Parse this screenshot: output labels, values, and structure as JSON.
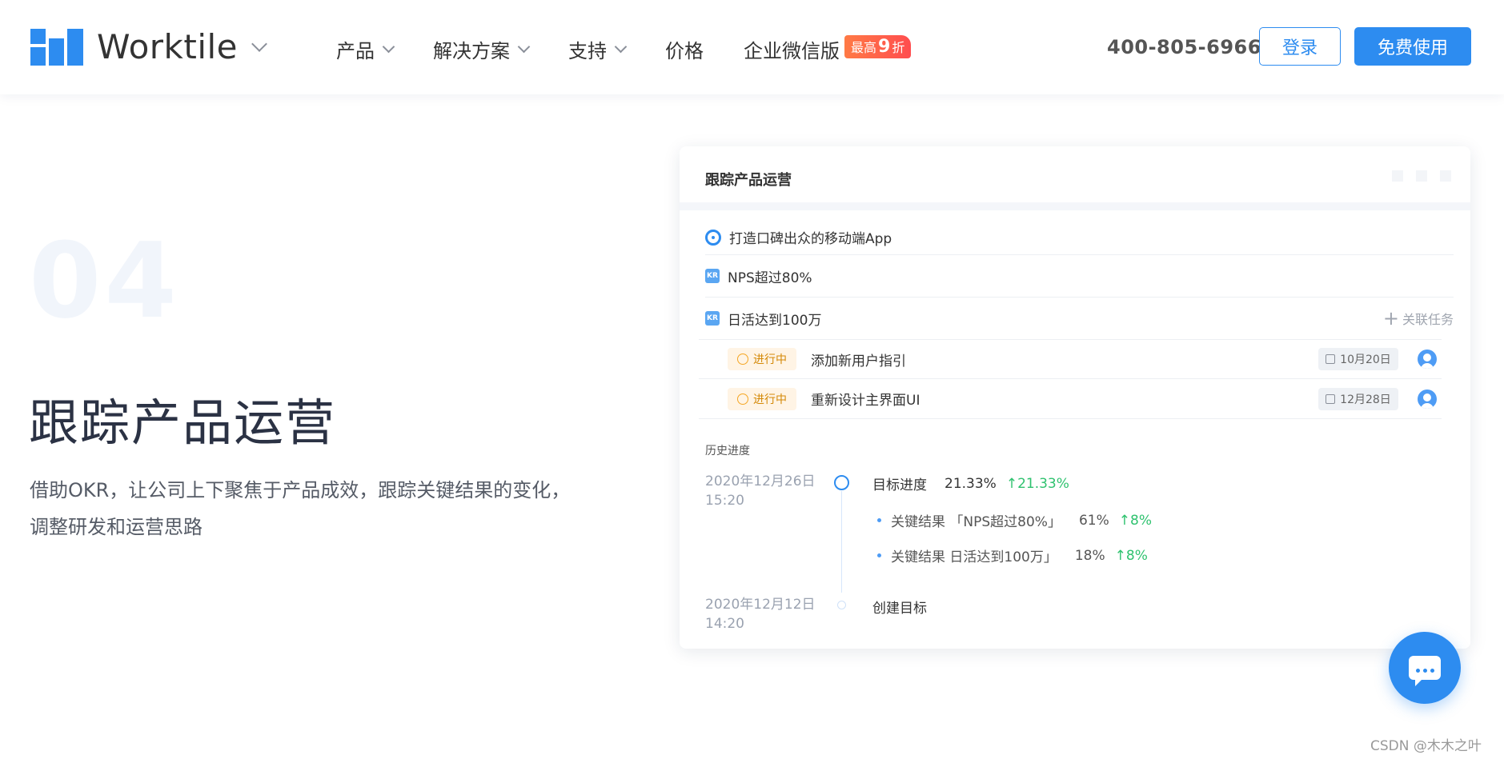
{
  "header": {
    "brand": "Worktile",
    "nav": [
      {
        "label": "产品",
        "dropdown": true
      },
      {
        "label": "解决方案",
        "dropdown": true
      },
      {
        "label": "支持",
        "dropdown": true
      },
      {
        "label": "价格",
        "dropdown": false
      },
      {
        "label": "企业微信版",
        "dropdown": false
      }
    ],
    "promo": {
      "prefix": "最高",
      "value": "9",
      "suffix": "折"
    },
    "phone": "400-805-6966",
    "login_label": "登录",
    "free_label": "免费使用"
  },
  "feature": {
    "number": "04",
    "title": "跟踪产品运营",
    "description": "借助OKR，让公司上下聚焦于产品成效，跟踪关键结果的变化，调整研发和运营思路"
  },
  "card": {
    "title": "跟踪产品运营",
    "objective": "打造口碑出众的移动端App",
    "key_results": [
      {
        "badge": "KR",
        "label": "NPS超过80%"
      },
      {
        "badge": "KR",
        "label": "日活达到100万"
      }
    ],
    "link_task_label": "关联任务",
    "tasks": [
      {
        "status": "进行中",
        "name": "添加新用户指引",
        "due": "10月20日"
      },
      {
        "status": "进行中",
        "name": "重新设计主界面UI",
        "due": "12月28日"
      }
    ],
    "history": {
      "label": "历史进度",
      "entries": [
        {
          "date": "2020年12月26日",
          "time": "15:20",
          "title": "目标进度",
          "percent": "21.33%",
          "delta": "21.33%",
          "details": [
            {
              "label": "关键结果 「NPS超过80%」",
              "percent": "61%",
              "delta": "8%"
            },
            {
              "label": "关键结果 日活达到100万」",
              "percent": "18%",
              "delta": "8%"
            }
          ]
        },
        {
          "date": "2020年12月12日",
          "time": "14:20",
          "title": "创建目标"
        }
      ]
    }
  },
  "watermark": "CSDN @木木之叶",
  "colors": {
    "primary": "#2d8cf0",
    "growth": "#2fc26f",
    "status_bg": "#fff4e5"
  }
}
